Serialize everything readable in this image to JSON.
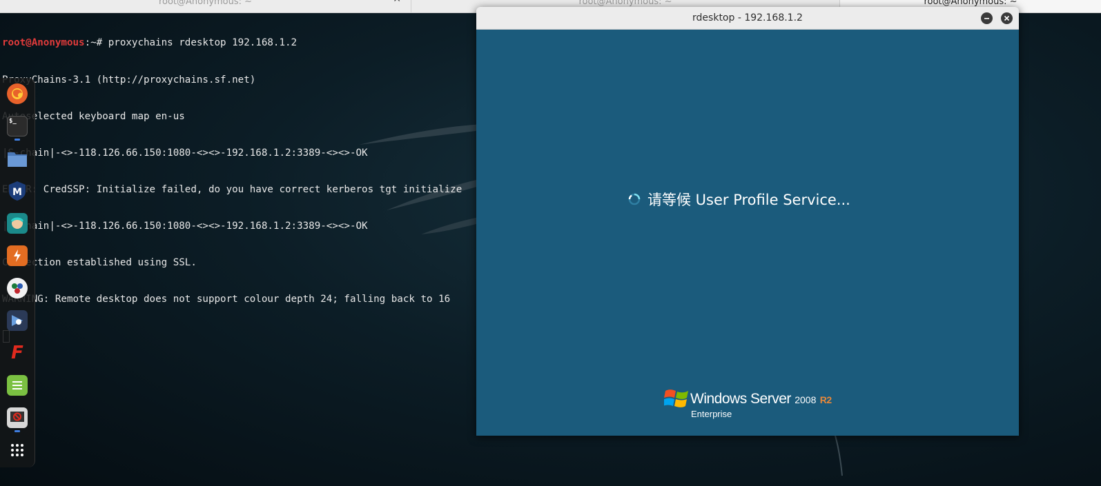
{
  "tabs": [
    {
      "label": "root@Anonymous: ~"
    },
    {
      "label": "root@Anonymous: ~"
    },
    {
      "label": "root@Anonymous: ~"
    }
  ],
  "terminal": {
    "prompt_user": "root@Anonymous",
    "prompt_path": ":~# ",
    "command": "proxychains rdesktop 192.168.1.2",
    "lines": [
      "ProxyChains-3.1 (http://proxychains.sf.net)",
      "Autoselected keyboard map en-us",
      "|S-chain|-<>-118.126.66.150:1080-<><>-192.168.1.2:3389-<><>-OK",
      "ERROR: CredSSP: Initialize failed, do you have correct kerberos tgt initialize",
      "|S-chain|-<>-118.126.66.150:1080-<><>-192.168.1.2:3389-<><>-OK",
      "Connection established using SSL.",
      "WARNING: Remote desktop does not support colour depth 24; falling back to 16"
    ]
  },
  "dock": {
    "items": [
      {
        "icon": "firefox-icon",
        "color": "#e8622b"
      },
      {
        "icon": "terminal-icon",
        "color": "#2b2b2b"
      },
      {
        "icon": "files-icon",
        "color": "#5b87c8"
      },
      {
        "icon": "metasploit-icon",
        "color": "#1c3d7a"
      },
      {
        "icon": "armitage-icon",
        "color": "#1b8a8a"
      },
      {
        "icon": "burpsuite-icon",
        "color": "#e36d22"
      },
      {
        "icon": "maltego-icon",
        "color": "#e8e8e8"
      },
      {
        "icon": "beef-icon",
        "color": "#2b3a57"
      },
      {
        "icon": "faraday-icon",
        "color": "#d42a1e"
      },
      {
        "icon": "leafpad-icon",
        "color": "#7bc142"
      },
      {
        "icon": "screenshot-icon",
        "color": "#d8d8d8"
      },
      {
        "icon": "app-grid-icon",
        "color": "#2a2a2a"
      }
    ]
  },
  "rdesktop": {
    "title": "rdesktop - 192.168.1.2",
    "status_text": "请等候 User Profile Service...",
    "brand_name": "Windows Server",
    "brand_version": "2008",
    "brand_r2": "R2",
    "brand_edition": "Enterprise",
    "screen_color": "#1b5b7c"
  }
}
